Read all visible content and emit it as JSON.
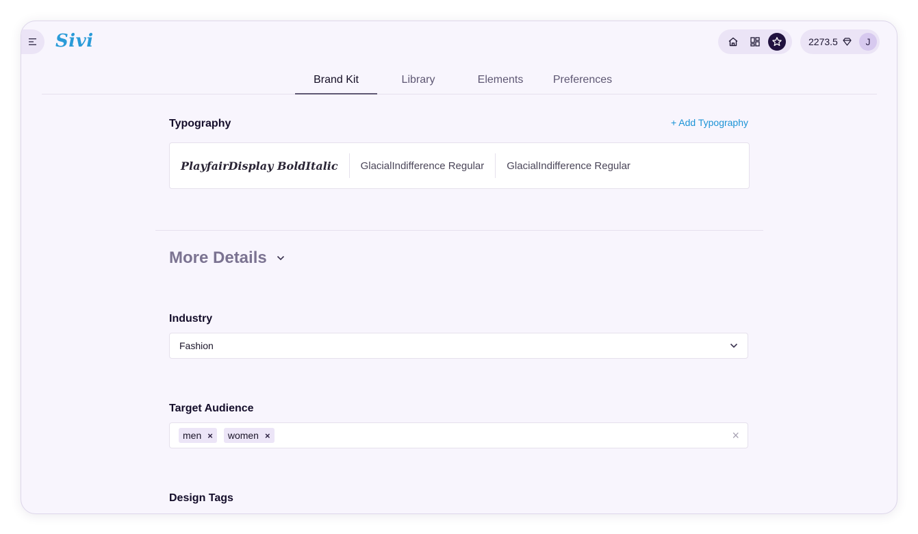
{
  "app": {
    "logo_text": "Sivi"
  },
  "header": {
    "credits_value": "2273.5",
    "avatar_initial": "J",
    "icons": [
      "home-icon",
      "templates-grid-icon",
      "star-icon",
      "diamond-icon",
      "menu-icon"
    ]
  },
  "tabs": [
    {
      "label": "Brand Kit",
      "active": true
    },
    {
      "label": "Library",
      "active": false
    },
    {
      "label": "Elements",
      "active": false
    },
    {
      "label": "Preferences",
      "active": false
    }
  ],
  "typography": {
    "title": "Typography",
    "add_label": "+ Add Typography",
    "fonts": [
      "PlayfairDisplay BoldItalic",
      "GlacialIndifference Regular",
      "GlacialIndifference Regular"
    ]
  },
  "more_details": {
    "title": "More Details"
  },
  "industry": {
    "label": "Industry",
    "value": "Fashion"
  },
  "target_audience": {
    "label": "Target Audience",
    "tags": [
      "men",
      "women"
    ],
    "remove_symbol": "×",
    "clear_symbol": "×"
  },
  "design_tags": {
    "label": "Design Tags"
  },
  "colors": {
    "accent_blue": "#1b93d6",
    "dark": "#21123f",
    "background": "#f8f5fd"
  }
}
